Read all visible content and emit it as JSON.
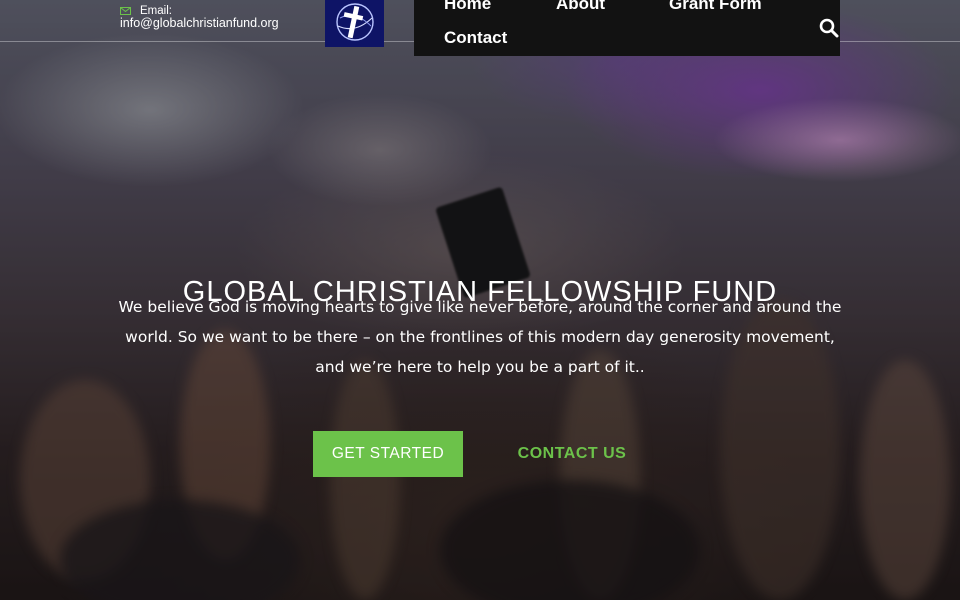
{
  "header": {
    "email_label": "Email:",
    "email_value": "info@globalchristianfund.org",
    "logo_icon": "cross-globe-logo",
    "nav": {
      "home": "Home",
      "about": "About",
      "grant_form": "Grant Form",
      "contact": "Contact"
    },
    "search_icon": "search-icon"
  },
  "hero": {
    "title": "GLOBAL CHRISTIAN FELLOWSHIP FUND",
    "text": "We believe God is moving hearts to give like never before, around the corner and around the world. So we want to be there – on the frontlines of this modern day generosity movement, and we’re here to help you be a part of it..",
    "primary_button": "GET STARTED",
    "secondary_button": "CONTACT US"
  },
  "colors": {
    "accent_green": "#6cc24a",
    "nav_bg": "#121212",
    "logo_bg": "#0e1466"
  }
}
